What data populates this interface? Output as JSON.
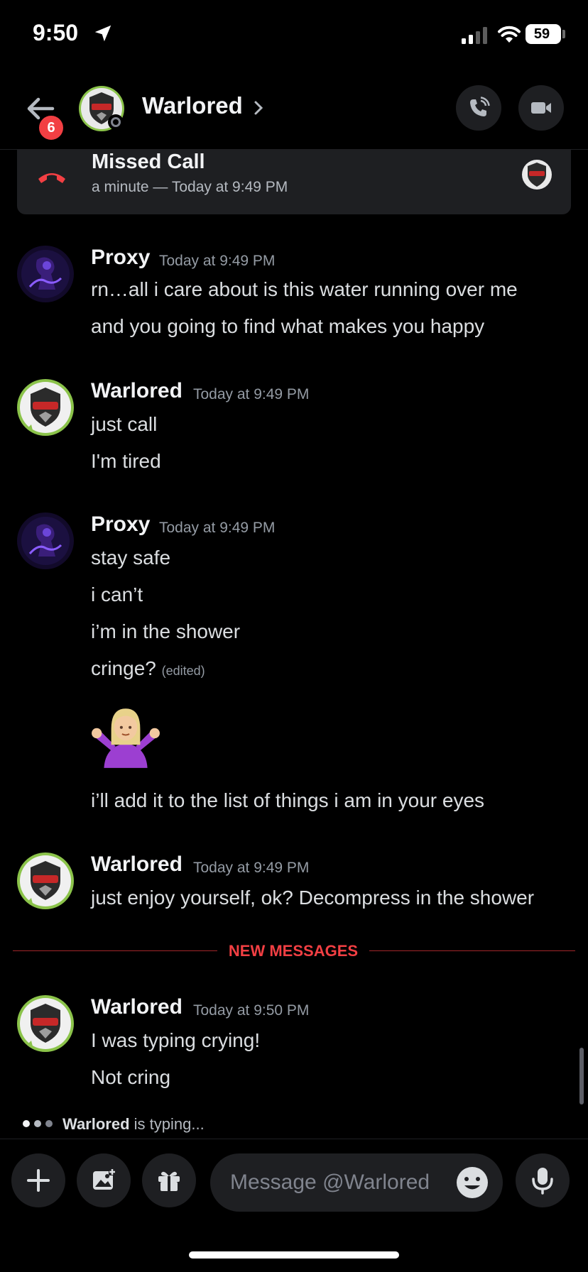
{
  "status_bar": {
    "time": "9:50",
    "battery": "59"
  },
  "header": {
    "back_badge": "6",
    "name": "Warlored"
  },
  "missed_call": {
    "title": "Missed Call",
    "subtitle": "a minute — Today at 9:49 PM"
  },
  "messages": [
    {
      "author": "Proxy",
      "time": "Today at 9:49 PM",
      "lines": [
        "rn…all i care about is this water running over me",
        "and you going to find what makes you happy"
      ]
    },
    {
      "author": "Warlored",
      "time": "Today at 9:49 PM",
      "lines": [
        "just call",
        "I'm tired"
      ]
    },
    {
      "author": "Proxy",
      "time": "Today at 9:49 PM",
      "lines": [
        "stay safe",
        "i can’t",
        "i’m in the shower",
        "cringe?"
      ],
      "edited": "(edited)",
      "emoji": "person-shrugging-emoji",
      "after_emoji": "i’ll add it to the list of things i am in your eyes"
    },
    {
      "author": "Warlored",
      "time": "Today at 9:49 PM",
      "lines": [
        "just enjoy yourself, ok? Decompress in the shower"
      ]
    },
    {
      "author": "Warlored",
      "time": "Today at 9:50 PM",
      "lines": [
        "I was typing crying!",
        "Not cring"
      ]
    }
  ],
  "divider": {
    "label": "NEW MESSAGES"
  },
  "typing": {
    "user": "Warlored",
    "text": " is typing..."
  },
  "composer": {
    "placeholder": "Message @Warlored"
  },
  "colors": {
    "background": "#000000",
    "surface": "#1e1f22",
    "accent_red": "#f23f43",
    "muted_text": "#949ba4"
  }
}
